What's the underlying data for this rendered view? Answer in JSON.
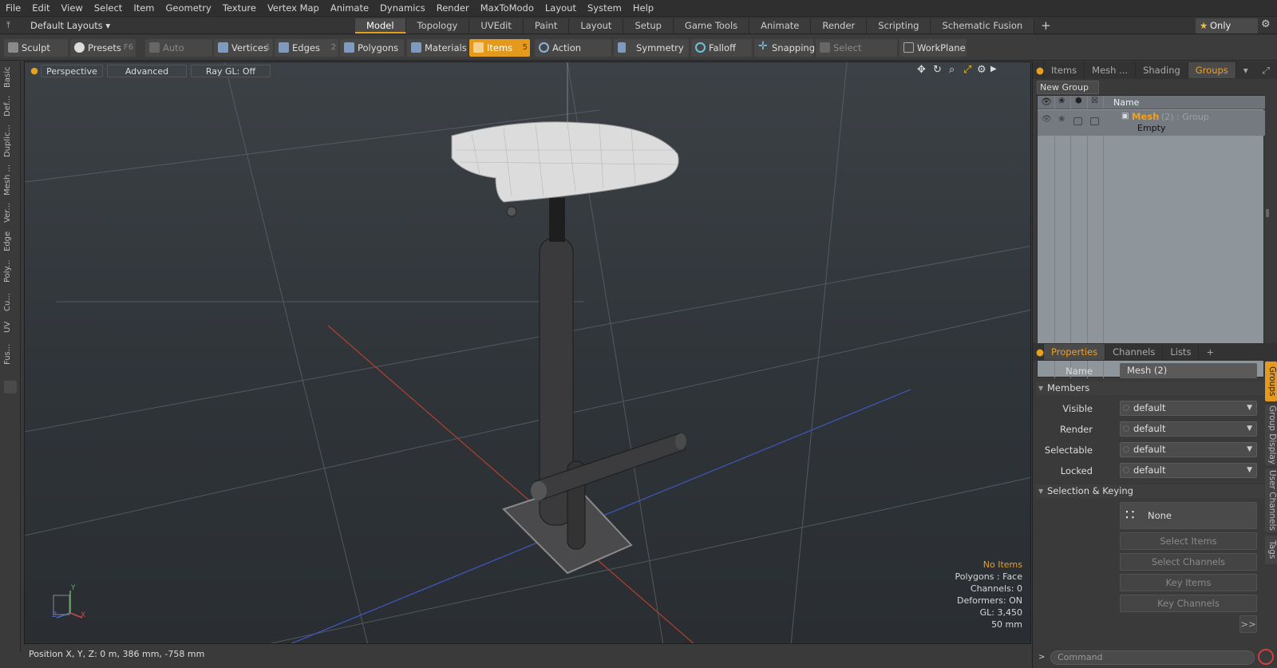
{
  "menubar": [
    "File",
    "Edit",
    "View",
    "Select",
    "Item",
    "Geometry",
    "Texture",
    "Vertex Map",
    "Animate",
    "Dynamics",
    "Render",
    "MaxToModo",
    "Layout",
    "System",
    "Help"
  ],
  "layoutbar": {
    "layout_select": "Default Layouts",
    "tabs": [
      "Model",
      "Topology",
      "UVEdit",
      "Paint",
      "Layout",
      "Setup",
      "Game Tools",
      "Animate",
      "Render",
      "Scripting",
      "Schematic Fusion"
    ],
    "active_tab": "Model",
    "only_label": "Only"
  },
  "toolbar": {
    "sculpt": "Sculpt",
    "presets": "Presets",
    "presets_key": "F6",
    "auto_select": "Auto Select",
    "vertices": "Vertices",
    "vertices_key": "1",
    "edges": "Edges",
    "edges_key": "2",
    "polygons": "Polygons",
    "materials": "Materials",
    "items": "Items",
    "items_key": "5",
    "action_center": "Action Center",
    "symmetry": "Symmetry",
    "falloff": "Falloff",
    "snapping": "Snapping",
    "select_through": "Select Through",
    "workplane": "WorkPlane"
  },
  "leftstrip": [
    "Basic",
    "Def...",
    "Duplic...",
    "Mesh ...",
    "Ver...",
    "Edge",
    "Poly...",
    "Cu...",
    "UV",
    "Fus..."
  ],
  "viewport": {
    "perspective": "Perspective",
    "advanced": "Advanced",
    "raygl": "Ray GL: Off",
    "info": {
      "no_items": "No Items",
      "polygons": "Polygons : Face",
      "channels": "Channels: 0",
      "deformers": "Deformers: ON",
      "gl": "GL: 3,450",
      "scale": "50 mm"
    },
    "axis_y": "Y",
    "axis_x": "X",
    "axis_z": "Z"
  },
  "status": {
    "position": "Position X, Y, Z:  0 m, 386 mm, -758 mm"
  },
  "groups_panel": {
    "tabs": [
      "Items",
      "Mesh ...",
      "Shading",
      "Groups"
    ],
    "active_tab": "Groups",
    "new_group": "New Group",
    "name_header": "Name",
    "group_name": "Mesh",
    "group_suffix": "(2) : Group",
    "group_content": "Empty"
  },
  "properties_panel": {
    "tabs": [
      "Properties",
      "Channels",
      "Lists"
    ],
    "active_tab": "Properties",
    "name_label": "Name",
    "name_value": "Mesh (2)",
    "members_section": "Members",
    "visible_label": "Visible",
    "visible_value": "default",
    "render_label": "Render",
    "render_value": "default",
    "selectable_label": "Selectable",
    "selectable_value": "default",
    "locked_label": "Locked",
    "locked_value": "default",
    "selection_section": "Selection & Keying",
    "none_value": "None",
    "select_items": "Select Items",
    "select_channels": "Select Channels",
    "key_items": "Key Items",
    "key_channels": "Key Channels",
    "more": ">>",
    "side_tabs": [
      "Groups",
      "Group Display",
      "User Channels",
      "Tags"
    ],
    "command_placeholder": "Command"
  },
  "colors": {
    "accent": "#e49a1c",
    "selected_orange": "#f0a020"
  }
}
